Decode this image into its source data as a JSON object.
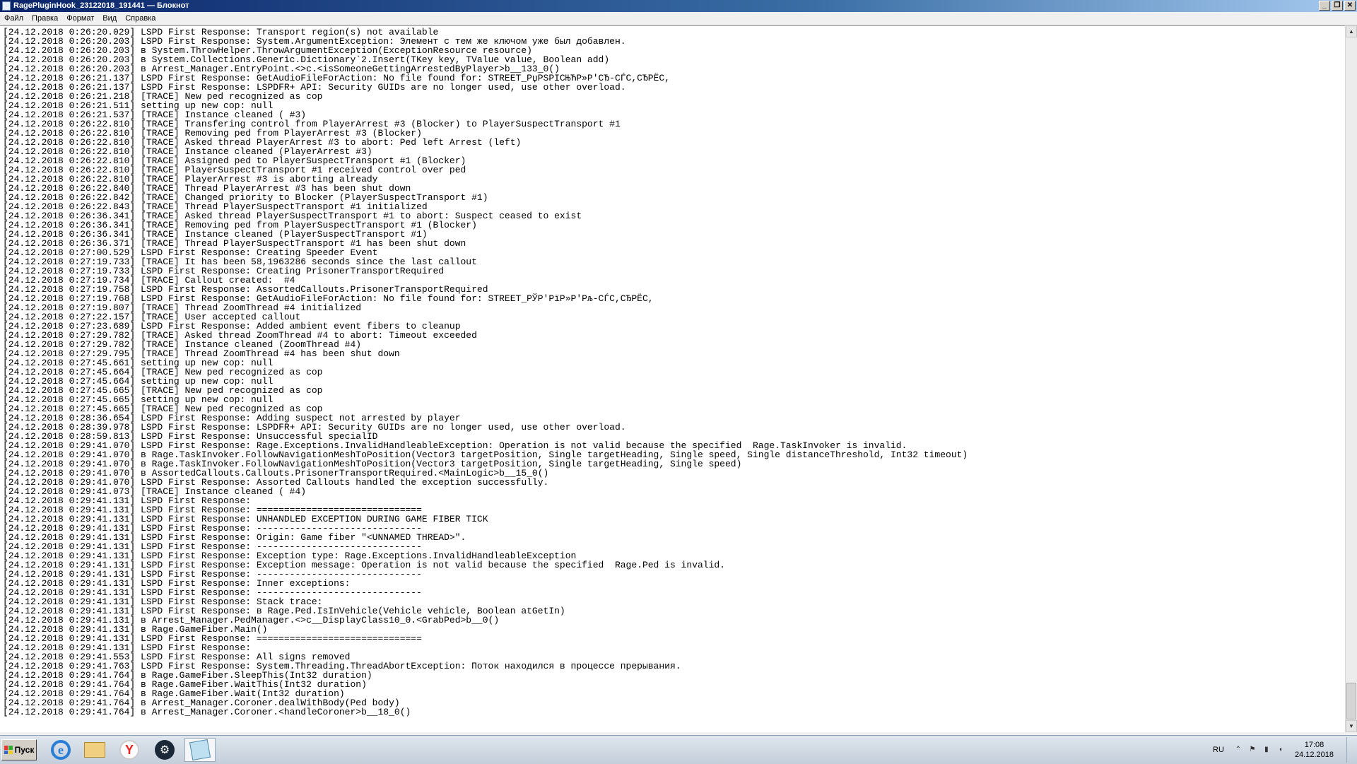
{
  "window": {
    "title": "RagePluginHook_23122018_191441 — Блокнот",
    "controls": {
      "minimize": "_",
      "maximize": "❐",
      "close": "✕"
    }
  },
  "menu": {
    "items": [
      "Файл",
      "Правка",
      "Формат",
      "Вид",
      "Справка"
    ]
  },
  "editor": {
    "lines": [
      "[24.12.2018 0:26:20.029] LSPD First Response: Transport region(s) not available",
      "[24.12.2018 0:26:20.203] LSPD First Response: System.ArgumentException: Элемент с тем же ключом уже был добавлен.",
      "[24.12.2018 0:26:20.203] в System.ThrowHelper.ThrowArgumentException(ExceptionResource resource)",
      "[24.12.2018 0:26:20.203] в System.Collections.Generic.Dictionary`2.Insert(TKey key, TValue value, Boolean add)",
      "[24.12.2018 0:26:20.203] в Arrest_Manager.EntryPoint.<>c.<isSomeoneGettingArrestedByPlayer>b__133_0()",
      "[24.12.2018 0:26:21.137] LSPD First Response: GetAudioFileForAction: No file found for: STREET_PџPSPIСЊЋP»P'СЂ-СЃС,СЂРЁС,",
      "[24.12.2018 0:26:21.137] LSPD First Response: LSPDFR+ API: Security GUIDs are no longer used, use other overload.",
      "[24.12.2018 0:26:21.218] [TRACE] New ped recognized as cop",
      "[24.12.2018 0:26:21.511] setting up new cop: null",
      "[24.12.2018 0:26:21.537] [TRACE] Instance cleaned ( #3)",
      "[24.12.2018 0:26:22.810] [TRACE] Transfering control from PlayerArrest #3 (Blocker) to PlayerSuspectTransport #1",
      "[24.12.2018 0:26:22.810] [TRACE] Removing ped from PlayerArrest #3 (Blocker)",
      "[24.12.2018 0:26:22.810] [TRACE] Asked thread PlayerArrest #3 to abort: Ped left Arrest (left)",
      "[24.12.2018 0:26:22.810] [TRACE] Instance cleaned (PlayerArrest #3)",
      "[24.12.2018 0:26:22.810] [TRACE] Assigned ped to PlayerSuspectTransport #1 (Blocker)",
      "[24.12.2018 0:26:22.810] [TRACE] PlayerSuspectTransport #1 received control over ped",
      "[24.12.2018 0:26:22.810] [TRACE] PlayerArrest #3 is aborting already",
      "[24.12.2018 0:26:22.840] [TRACE] Thread PlayerArrest #3 has been shut down",
      "[24.12.2018 0:26:22.842] [TRACE] Changed priority to Blocker (PlayerSuspectTransport #1)",
      "[24.12.2018 0:26:22.843] [TRACE] Thread PlayerSuspectTransport #1 initialized",
      "[24.12.2018 0:26:36.341] [TRACE] Asked thread PlayerSuspectTransport #1 to abort: Suspect ceased to exist",
      "[24.12.2018 0:26:36.341] [TRACE] Removing ped from PlayerSuspectTransport #1 (Blocker)",
      "[24.12.2018 0:26:36.341] [TRACE] Instance cleaned (PlayerSuspectTransport #1)",
      "[24.12.2018 0:26:36.371] [TRACE] Thread PlayerSuspectTransport #1 has been shut down",
      "[24.12.2018 0:27:00.529] LSPD First Response: Creating Speeder Event",
      "[24.12.2018 0:27:19.733] [TRACE] It has been 58,1963286 seconds since the last callout",
      "[24.12.2018 0:27:19.733] LSPD First Response: Creating PrisonerTransportRequired",
      "[24.12.2018 0:27:19.734] [TRACE] Callout created:  #4",
      "[24.12.2018 0:27:19.758] LSPD First Response: AssortedCallouts.PrisonerTransportRequired",
      "[24.12.2018 0:27:19.768] LSPD First Response: GetAudioFileForAction: No file found for: STREET_РЎР'РїР»Р'Рљ-СЃС,СЂРЁС,",
      "[24.12.2018 0:27:19.807] [TRACE] Thread ZoomThread #4 initialized",
      "[24.12.2018 0:27:22.157] [TRACE] User accepted callout",
      "[24.12.2018 0:27:23.689] LSPD First Response: Added ambient event fibers to cleanup",
      "[24.12.2018 0:27:29.782] [TRACE] Asked thread ZoomThread #4 to abort: Timeout exceeded",
      "[24.12.2018 0:27:29.782] [TRACE] Instance cleaned (ZoomThread #4)",
      "[24.12.2018 0:27:29.795] [TRACE] Thread ZoomThread #4 has been shut down",
      "[24.12.2018 0:27:45.661] setting up new cop: null",
      "[24.12.2018 0:27:45.664] [TRACE] New ped recognized as cop",
      "[24.12.2018 0:27:45.664] setting up new cop: null",
      "[24.12.2018 0:27:45.665] [TRACE] New ped recognized as cop",
      "[24.12.2018 0:27:45.665] setting up new cop: null",
      "[24.12.2018 0:27:45.665] [TRACE] New ped recognized as cop",
      "[24.12.2018 0:28:36.654] LSPD First Response: Adding suspect not arrested by player",
      "[24.12.2018 0:28:39.978] LSPD First Response: LSPDFR+ API: Security GUIDs are no longer used, use other overload.",
      "[24.12.2018 0:28:59.813] LSPD First Response: Unsuccessful specialID",
      "[24.12.2018 0:29:41.070] LSPD First Response: Rage.Exceptions.InvalidHandleableException: Operation is not valid because the specified  Rage.TaskInvoker is invalid.",
      "[24.12.2018 0:29:41.070] в Rage.TaskInvoker.FollowNavigationMeshToPosition(Vector3 targetPosition, Single targetHeading, Single speed, Single distanceThreshold, Int32 timeout)",
      "[24.12.2018 0:29:41.070] в Rage.TaskInvoker.FollowNavigationMeshToPosition(Vector3 targetPosition, Single targetHeading, Single speed)",
      "[24.12.2018 0:29:41.070] в AssortedCallouts.Callouts.PrisonerTransportRequired.<MainLogic>b__15_0()",
      "[24.12.2018 0:29:41.070] LSPD First Response: Assorted Callouts handled the exception successfully.",
      "[24.12.2018 0:29:41.073] [TRACE] Instance cleaned ( #4)",
      "[24.12.2018 0:29:41.131] LSPD First Response:",
      "[24.12.2018 0:29:41.131] LSPD First Response: ==============================",
      "[24.12.2018 0:29:41.131] LSPD First Response: UNHANDLED EXCEPTION DURING GAME FIBER TICK",
      "[24.12.2018 0:29:41.131] LSPD First Response: ------------------------------",
      "[24.12.2018 0:29:41.131] LSPD First Response: Origin: Game fiber \"<UNNAMED THREAD>\".",
      "[24.12.2018 0:29:41.131] LSPD First Response: ------------------------------",
      "[24.12.2018 0:29:41.131] LSPD First Response: Exception type: Rage.Exceptions.InvalidHandleableException",
      "[24.12.2018 0:29:41.131] LSPD First Response: Exception message: Operation is not valid because the specified  Rage.Ped is invalid.",
      "[24.12.2018 0:29:41.131] LSPD First Response: ------------------------------",
      "[24.12.2018 0:29:41.131] LSPD First Response: Inner exceptions:",
      "[24.12.2018 0:29:41.131] LSPD First Response: ------------------------------",
      "[24.12.2018 0:29:41.131] LSPD First Response: Stack trace:",
      "[24.12.2018 0:29:41.131] LSPD First Response: в Rage.Ped.IsInVehicle(Vehicle vehicle, Boolean atGetIn)",
      "[24.12.2018 0:29:41.131] в Arrest_Manager.PedManager.<>c__DisplayClass10_0.<GrabPed>b__0()",
      "[24.12.2018 0:29:41.131] в Rage.GameFiber.Main()",
      "[24.12.2018 0:29:41.131] LSPD First Response: ==============================",
      "[24.12.2018 0:29:41.131] LSPD First Response:",
      "[24.12.2018 0:29:41.553] LSPD First Response: All signs removed",
      "[24.12.2018 0:29:41.763] LSPD First Response: System.Threading.ThreadAbortException: Поток находился в процессе прерывания.",
      "[24.12.2018 0:29:41.764] в Rage.GameFiber.SleepThis(Int32 duration)",
      "[24.12.2018 0:29:41.764] в Rage.GameFiber.WaitThis(Int32 duration)",
      "[24.12.2018 0:29:41.764] в Rage.GameFiber.Wait(Int32 duration)",
      "[24.12.2018 0:29:41.764] в Arrest_Manager.Coroner.dealWithBody(Ped body)",
      "[24.12.2018 0:29:41.764] в Arrest_Manager.Coroner.<handleCoroner>b__18_0()"
    ]
  },
  "taskbar": {
    "start_label": "Пуск",
    "pinned": [
      {
        "name": "internet-explorer",
        "icon": "ie-icon",
        "glyph": "e"
      },
      {
        "name": "explorer",
        "icon": "folder-icon",
        "glyph": ""
      },
      {
        "name": "yandex-browser",
        "icon": "yandex-icon",
        "glyph": "Y"
      },
      {
        "name": "steam",
        "icon": "steam-icon",
        "glyph": "⚙"
      },
      {
        "name": "notepad",
        "icon": "notepad-icon",
        "glyph": ""
      }
    ],
    "tray": {
      "language": "RU",
      "time": "17:08",
      "date": "24.12.2018"
    }
  },
  "colors": {
    "titlebar_start": "#0a246a",
    "titlebar_end": "#a6caf0",
    "taskbar": "#c4ceda"
  }
}
